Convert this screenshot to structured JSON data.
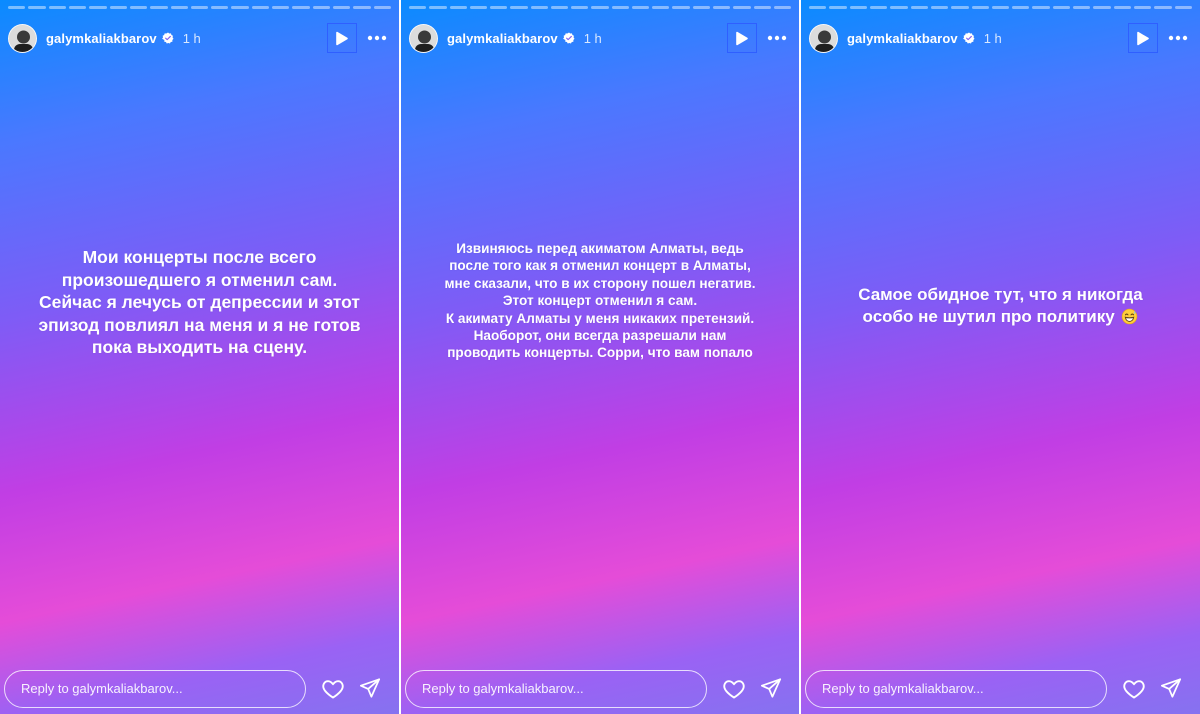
{
  "stories": [
    {
      "username": "galymkaliakbarov",
      "time": "1 h",
      "reply_placeholder": "Reply to galymkaliakbarov...",
      "progress_total": 19,
      "progress_completed": 0,
      "text_lines": [
        "Мои концерты после всего",
        "произошедшего я отменил сам.",
        "Сейчас я лечусь от депрессии и этот",
        "эпизод повлиял на меня и я не готов",
        "пока выходить на сцену."
      ]
    },
    {
      "username": "galymkaliakbarov",
      "time": "1 h",
      "reply_placeholder": "Reply to galymkaliakbarov...",
      "progress_total": 19,
      "progress_completed": 0,
      "text_lines": [
        "Извиняюсь перед акиматом Алматы, ведь",
        "после того как я отменил концерт в Алматы,",
        "мне сказали, что в их сторону пошел негатив.",
        "Этот концерт отменил я сам.",
        "К акимату Алматы у меня никаких претензий.",
        "Наоборот, они всегда разрешали нам",
        "проводить концерты. Сорри, что вам попало"
      ]
    },
    {
      "username": "galymkaliakbarov",
      "time": "1 h",
      "reply_placeholder": "Reply to galymkaliakbarov...",
      "progress_total": 19,
      "progress_completed": 0,
      "text_lines": [
        "Самое обидное тут, что я никогда",
        "особо не шутил про политику"
      ],
      "emoji": "grinning-sweat-emoji"
    }
  ],
  "colors": {
    "play_focus_border": "#2f5fff",
    "verified_badge": "#ffffff"
  },
  "icons": {
    "verified": "verified-badge-icon",
    "play": "play-icon",
    "more": "more-horizontal-icon",
    "heart": "heart-icon",
    "send": "send-icon"
  }
}
